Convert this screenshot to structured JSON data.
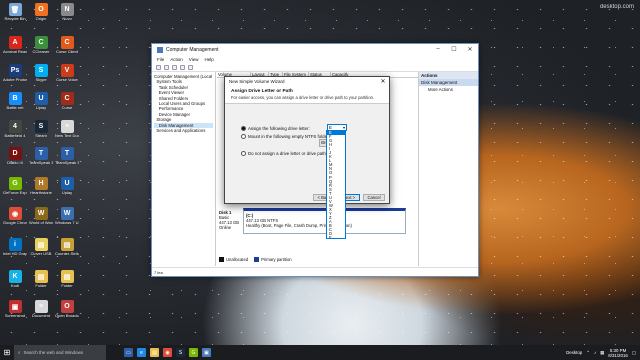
{
  "desktop": {
    "credit": "desktop.com",
    "icons": [
      {
        "label": "Recycle Bin",
        "color": "#7aa7d6",
        "glyph": "🗑"
      },
      {
        "label": "Origin",
        "color": "#f27121",
        "glyph": "O"
      },
      {
        "label": "Nuvo",
        "color": "#8a8a8a",
        "glyph": "N"
      },
      {
        "label": "Acrobat Reader DC",
        "color": "#d9261c",
        "glyph": "A"
      },
      {
        "label": "CCleaner",
        "color": "#3a8f3a",
        "glyph": "C"
      },
      {
        "label": "Curse Client",
        "color": "#e05a1c",
        "glyph": "C"
      },
      {
        "label": "Adobe Photoshop",
        "color": "#1c3c7c",
        "glyph": "Ps"
      },
      {
        "label": "Skype",
        "color": "#00aff0",
        "glyph": "S"
      },
      {
        "label": "Curse Voice",
        "color": "#cc3b1a",
        "glyph": "V"
      },
      {
        "label": "Battle.net",
        "color": "#148eff",
        "glyph": "B"
      },
      {
        "label": "Uplay",
        "color": "#1c5ea8",
        "glyph": "U"
      },
      {
        "label": "Curse",
        "color": "#a12b1b",
        "glyph": "C"
      },
      {
        "label": "Battlefield 4",
        "color": "#454545",
        "glyph": "4"
      },
      {
        "label": "Steam",
        "color": "#1b2838",
        "glyph": "S"
      },
      {
        "label": "New Text Document",
        "color": "#d8d8d8",
        "glyph": "≡"
      },
      {
        "label": "Diablo III",
        "color": "#7a1010",
        "glyph": "D"
      },
      {
        "label": "TeamSpeak 3 Client",
        "color": "#2d5fa8",
        "glyph": "T"
      },
      {
        "label": "TeamSpeak 3 Client",
        "color": "#2d5fa8",
        "glyph": "T"
      },
      {
        "label": "GeForce Experience",
        "color": "#76b900",
        "glyph": "G"
      },
      {
        "label": "Hearthstone",
        "color": "#b07a2a",
        "glyph": "H"
      },
      {
        "label": "Uplay",
        "color": "#1c5ea8",
        "glyph": "U"
      },
      {
        "label": "Google Chrome",
        "color": "#dd4b39",
        "glyph": "◉"
      },
      {
        "label": "World of Warcraft",
        "color": "#8a6a1a",
        "glyph": "W"
      },
      {
        "label": "Windows 7 USB DVD...",
        "color": "#3a6fb0",
        "glyph": "W"
      },
      {
        "label": "Intel HD Graphics C...",
        "color": "#0071c5",
        "glyph": "i"
      },
      {
        "label": "Clover USB",
        "color": "#e8d060",
        "glyph": "▤"
      },
      {
        "label": "Counter-Strike",
        "color": "#c8a038",
        "glyph": "▤"
      },
      {
        "label": "Kodi",
        "color": "#17b2e7",
        "glyph": "K"
      },
      {
        "label": "Folder",
        "color": "#e8c050",
        "glyph": "▤"
      },
      {
        "label": "Folder",
        "color": "#e8c050",
        "glyph": "▤"
      },
      {
        "label": "Screenshot",
        "color": "#c03030",
        "glyph": "▣"
      },
      {
        "label": "Document",
        "color": "#d8d8d8",
        "glyph": "≡"
      },
      {
        "label": "Open Broadcaster",
        "color": "#c04040",
        "glyph": "O"
      }
    ]
  },
  "cm": {
    "title": "Computer Management",
    "menu": [
      "File",
      "Action",
      "View",
      "Help"
    ],
    "tree": [
      {
        "label": "Computer Management (Local",
        "sel": false
      },
      {
        "label": "  System Tools",
        "sel": false
      },
      {
        "label": "    Task Scheduler",
        "sel": false
      },
      {
        "label": "    Event Viewer",
        "sel": false
      },
      {
        "label": "    Shared Folders",
        "sel": false
      },
      {
        "label": "    Local Users and Groups",
        "sel": false
      },
      {
        "label": "    Performance",
        "sel": false
      },
      {
        "label": "    Device Manager",
        "sel": false
      },
      {
        "label": "  Storage",
        "sel": false
      },
      {
        "label": "    Disk Management",
        "sel": true
      },
      {
        "label": "  Services and Applications",
        "sel": false
      }
    ],
    "columns": [
      "Volume",
      "Layout",
      "Type",
      "File System",
      "Status",
      "Capacity"
    ],
    "actions": {
      "header": "Actions",
      "sub": "Disk Management",
      "more": "More Actions"
    },
    "disk": {
      "name": "Disk 1",
      "type": "Basic",
      "size": "447.13 GB",
      "state": "Online",
      "vol_label": "(C:)",
      "vol_size": "447.13 GB NTFS",
      "vol_status": "Healthy (Boot, Page File, Crash Dump, Primary Partition)"
    },
    "legend": {
      "unallocated": "Unallocated",
      "primary": "Primary partition"
    },
    "status_char": "7 lea"
  },
  "wizard": {
    "title": "New Simple Volume Wizard",
    "heading": "Assign Drive Letter or Path",
    "subheading": "For easier access, you can assign a drive letter or drive path to your partition.",
    "opt_assign": "Assign the following drive letter:",
    "opt_mount": "Mount in the following empty NTFS folder:",
    "opt_none": "Do not assign a drive letter or drive path",
    "selected_letter": "E",
    "browse": "Browse...",
    "back": "< Back",
    "next": "Next >",
    "cancel": "Cancel"
  },
  "letters": [
    "E",
    "F",
    "G",
    "H",
    "I",
    "J",
    "K",
    "L",
    "M",
    "N",
    "O",
    "P",
    "Q",
    "R",
    "S",
    "T",
    "U",
    "V",
    "W",
    "X",
    "Y",
    "Z",
    "A",
    "B",
    "C",
    "D",
    "E"
  ],
  "taskbar": {
    "search_placeholder": "Search the web and Windows",
    "desktop_label": "Desktop",
    "time": "5:30 PM",
    "date": "8/31/2016"
  },
  "colors": {
    "primary_partition": "#1a3c9a",
    "unallocated": "#111111",
    "accent": "#0078d7"
  }
}
